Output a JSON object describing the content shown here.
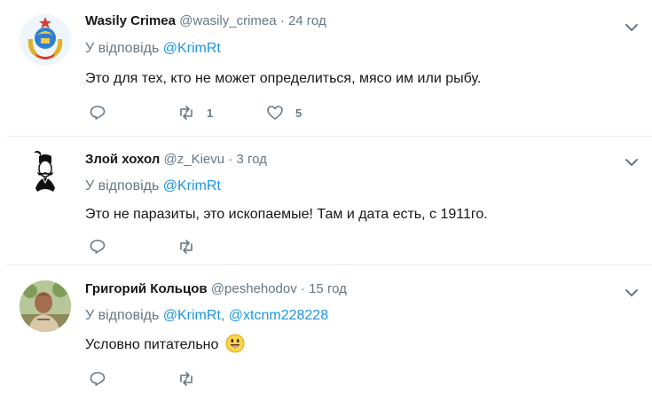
{
  "tweets": [
    {
      "name": "Wasily Crimea",
      "handle": "@wasily_crimea",
      "dot": "·",
      "time": "24 год",
      "reply_prefix": "У відповідь",
      "mentions": [
        "@KrimRt"
      ],
      "text": "Это для тех, кто не может определиться, мясо им или рыбу.",
      "retweets": "1",
      "likes": "5",
      "avatar": "coat-of-arms-avatar"
    },
    {
      "name": "Злой хохол",
      "handle": "@z_Kievu",
      "dot": "·",
      "time": "3 год",
      "reply_prefix": "У відповідь",
      "mentions": [
        "@KrimRt"
      ],
      "text": "Это не паразиты, это ископаемые! Там и дата есть, с 1911го.",
      "retweets": "",
      "likes": "",
      "avatar": "cossack-sketch-avatar"
    },
    {
      "name": "Григорий Кольцов",
      "handle": "@peshehodov",
      "dot": "·",
      "time": "15 год",
      "reply_prefix": "У відповідь",
      "mentions": [
        "@KrimRt",
        "@xtcnm228228"
      ],
      "mention_separator": ",",
      "text": "Условно питательно",
      "emoji": "😃",
      "retweets": "",
      "likes": "",
      "avatar": "photo-avatar"
    }
  ],
  "colors": {
    "link": "#1b95e0",
    "secondary": "#657786",
    "separator": "#e6ecf0"
  }
}
